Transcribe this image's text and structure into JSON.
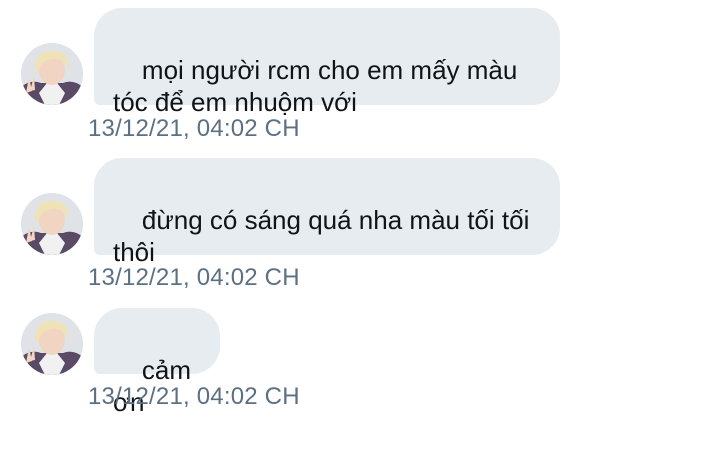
{
  "conversation": {
    "messages": [
      {
        "text": "mọi người rcm cho em mấy màu\ntóc để em nhuộm với",
        "timestamp": "13/12/21, 04:02 CH",
        "avatar_icon": "user-avatar-icon"
      },
      {
        "text": "đừng có sáng quá nha màu tối tối\nthôi",
        "timestamp": "13/12/21, 04:02 CH",
        "avatar_icon": "user-avatar-icon"
      },
      {
        "text": "cảm ơn",
        "timestamp": "13/12/21, 04:02 CH",
        "avatar_icon": "user-avatar-icon"
      }
    ]
  },
  "colors": {
    "bubble_background": "#e6ecf0",
    "message_text": "#0f1419",
    "timestamp_text": "#5b7083",
    "page_background": "#ffffff"
  }
}
